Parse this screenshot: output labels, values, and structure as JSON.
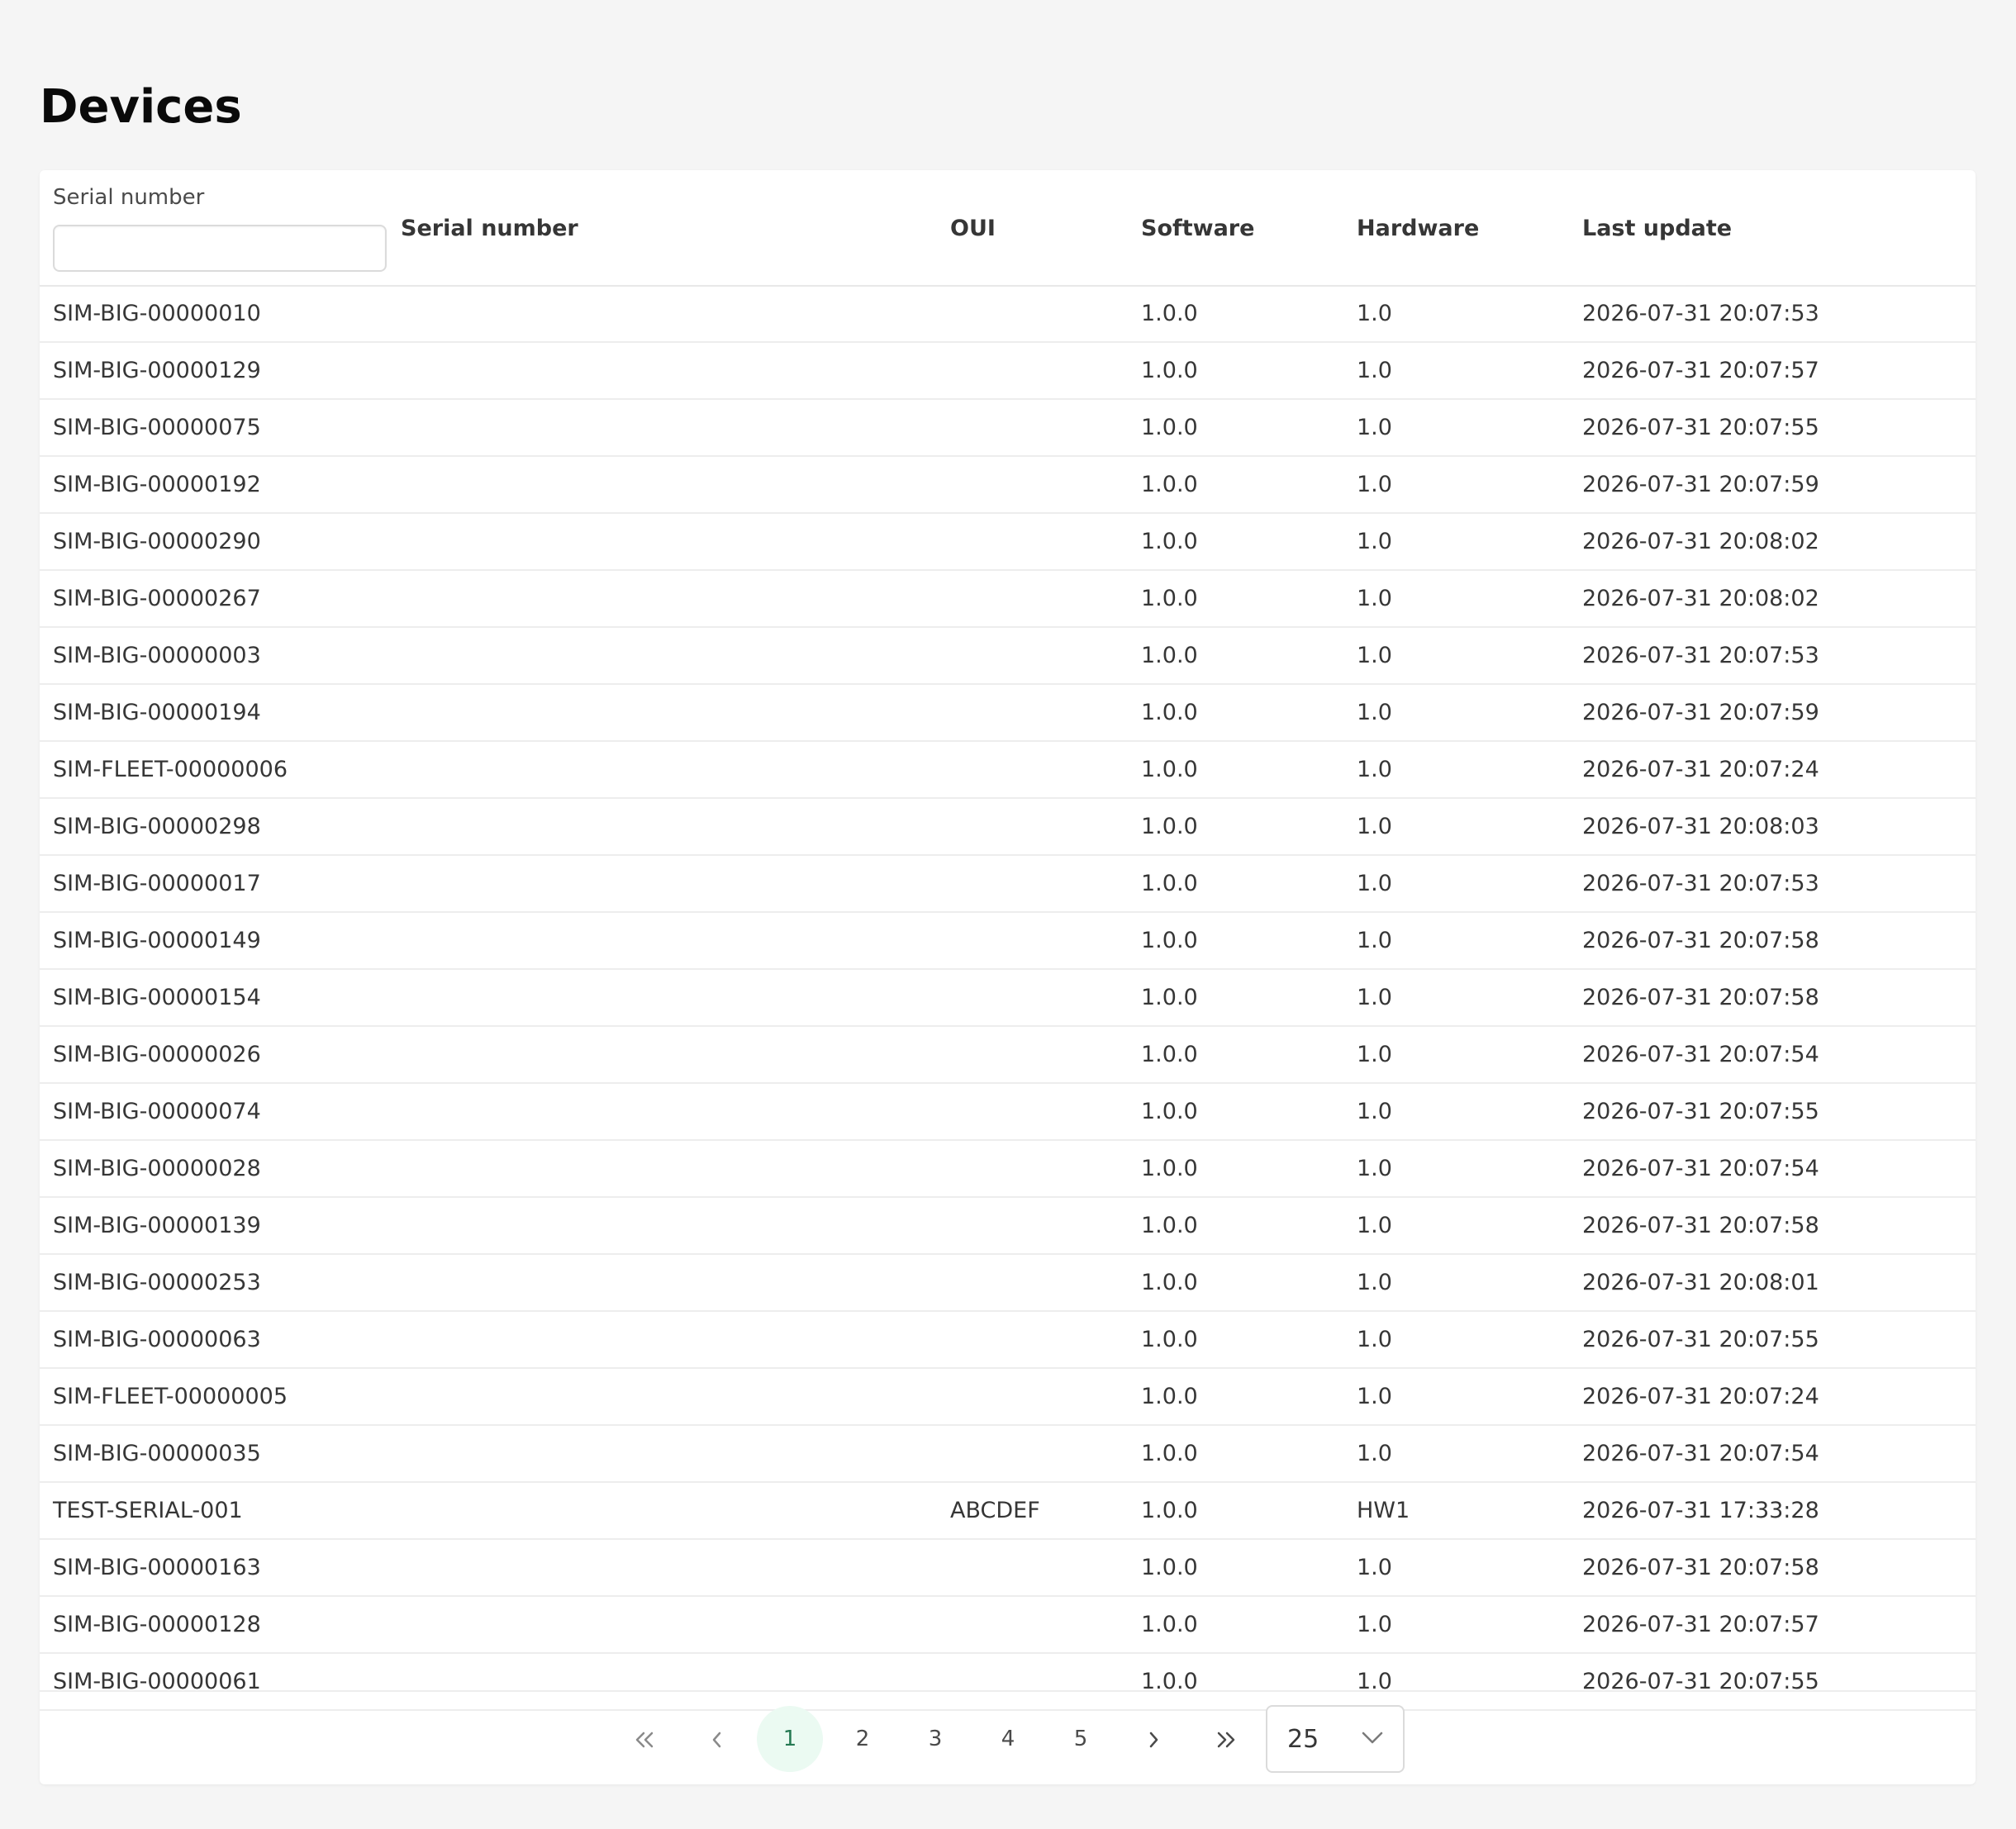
{
  "page": {
    "title": "Devices"
  },
  "filter": {
    "label": "Serial number",
    "value": "",
    "placeholder": ""
  },
  "table": {
    "columns": [
      "Serial number",
      "OUI",
      "Software",
      "Hardware",
      "Last update"
    ],
    "rows": [
      [
        "SIM-BIG-00000010",
        "",
        "1.0.0",
        "1.0",
        "2026-07-31 20:07:53"
      ],
      [
        "SIM-BIG-00000129",
        "",
        "1.0.0",
        "1.0",
        "2026-07-31 20:07:57"
      ],
      [
        "SIM-BIG-00000075",
        "",
        "1.0.0",
        "1.0",
        "2026-07-31 20:07:55"
      ],
      [
        "SIM-BIG-00000192",
        "",
        "1.0.0",
        "1.0",
        "2026-07-31 20:07:59"
      ],
      [
        "SIM-BIG-00000290",
        "",
        "1.0.0",
        "1.0",
        "2026-07-31 20:08:02"
      ],
      [
        "SIM-BIG-00000267",
        "",
        "1.0.0",
        "1.0",
        "2026-07-31 20:08:02"
      ],
      [
        "SIM-BIG-00000003",
        "",
        "1.0.0",
        "1.0",
        "2026-07-31 20:07:53"
      ],
      [
        "SIM-BIG-00000194",
        "",
        "1.0.0",
        "1.0",
        "2026-07-31 20:07:59"
      ],
      [
        "SIM-FLEET-00000006",
        "",
        "1.0.0",
        "1.0",
        "2026-07-31 20:07:24"
      ],
      [
        "SIM-BIG-00000298",
        "",
        "1.0.0",
        "1.0",
        "2026-07-31 20:08:03"
      ],
      [
        "SIM-BIG-00000017",
        "",
        "1.0.0",
        "1.0",
        "2026-07-31 20:07:53"
      ],
      [
        "SIM-BIG-00000149",
        "",
        "1.0.0",
        "1.0",
        "2026-07-31 20:07:58"
      ],
      [
        "SIM-BIG-00000154",
        "",
        "1.0.0",
        "1.0",
        "2026-07-31 20:07:58"
      ],
      [
        "SIM-BIG-00000026",
        "",
        "1.0.0",
        "1.0",
        "2026-07-31 20:07:54"
      ],
      [
        "SIM-BIG-00000074",
        "",
        "1.0.0",
        "1.0",
        "2026-07-31 20:07:55"
      ],
      [
        "SIM-BIG-00000028",
        "",
        "1.0.0",
        "1.0",
        "2026-07-31 20:07:54"
      ],
      [
        "SIM-BIG-00000139",
        "",
        "1.0.0",
        "1.0",
        "2026-07-31 20:07:58"
      ],
      [
        "SIM-BIG-00000253",
        "",
        "1.0.0",
        "1.0",
        "2026-07-31 20:08:01"
      ],
      [
        "SIM-BIG-00000063",
        "",
        "1.0.0",
        "1.0",
        "2026-07-31 20:07:55"
      ],
      [
        "SIM-FLEET-00000005",
        "",
        "1.0.0",
        "1.0",
        "2026-07-31 20:07:24"
      ],
      [
        "SIM-BIG-00000035",
        "",
        "1.0.0",
        "1.0",
        "2026-07-31 20:07:54"
      ],
      [
        "TEST-SERIAL-001",
        "ABCDEF",
        "1.0.0",
        "HW1",
        "2026-07-31 17:33:28"
      ],
      [
        "SIM-BIG-00000163",
        "",
        "1.0.0",
        "1.0",
        "2026-07-31 20:07:58"
      ],
      [
        "SIM-BIG-00000128",
        "",
        "1.0.0",
        "1.0",
        "2026-07-31 20:07:57"
      ],
      [
        "SIM-BIG-00000061",
        "",
        "1.0.0",
        "1.0",
        "2026-07-31 20:07:55"
      ]
    ]
  },
  "pagination": {
    "first_icon": "double-chevron-left-icon",
    "prev_icon": "chevron-left-icon",
    "pages": [
      "1",
      "2",
      "3",
      "4",
      "5"
    ],
    "current_page": "1",
    "next_icon": "chevron-right-icon",
    "last_icon": "double-chevron-right-icon",
    "per_page": "25",
    "per_page_icon": "chevron-down-icon"
  },
  "colors": {
    "background": "#f5f5f5",
    "card": "#ffffff",
    "current_page_bg": "#ebfaf2",
    "current_page_text": "#257953"
  }
}
